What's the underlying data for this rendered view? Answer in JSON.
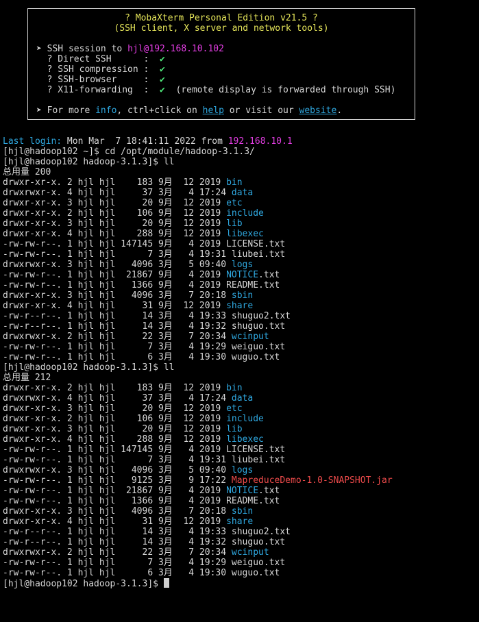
{
  "colors": {
    "background": "#000000",
    "text": "#d8d8d8",
    "banner_title": "#e6e65a",
    "check": "#4ee87a",
    "host": "#e23de2",
    "directory": "#2fa8e0",
    "archive": "#ef4b4b"
  },
  "banner": {
    "title": "? MobaXterm Personal Edition v21.5 ?",
    "subtitle": "(SSH client, X server and network tools)",
    "session_prefix": "➤ SSH session to ",
    "session_host": "hjl@192.168.10.102",
    "features": [
      {
        "label": "  ? Direct SSH      :  ",
        "check": "✔",
        "note": ""
      },
      {
        "label": "  ? SSH compression :  ",
        "check": "✔",
        "note": ""
      },
      {
        "label": "  ? SSH-browser     :  ",
        "check": "✔",
        "note": ""
      },
      {
        "label": "  ? X11-forwarding  :  ",
        "check": "✔",
        "note": "  (remote display is forwarded through SSH)"
      }
    ],
    "more_prefix": "➤ For more ",
    "info_text": "info",
    "more_mid": ", ctrl+click on ",
    "help_text": "help",
    "more_or": " or visit our ",
    "website_text": "website",
    "more_end": "."
  },
  "session": {
    "last_login_label": "Last login:",
    "last_login_time": " Mon Mar  7 18:41:11 2022 from ",
    "last_login_host": "192.168.10.1",
    "commands": [
      "[hjl@hadoop102 ~]$ cd /opt/module/hadoop-3.1.3/",
      "[hjl@hadoop102 hadoop-3.1.3]$ ll"
    ],
    "listing1_total": "总用量 200",
    "listing1": [
      {
        "meta": "drwxr-xr-x. 2 hjl hjl    183 9月  12 2019 ",
        "name": "bin",
        "kind": "dir"
      },
      {
        "meta": "drwxrwxr-x. 4 hjl hjl     37 3月   4 17:24 ",
        "name": "data",
        "kind": "dir"
      },
      {
        "meta": "drwxr-xr-x. 3 hjl hjl     20 9月  12 2019 ",
        "name": "etc",
        "kind": "dir"
      },
      {
        "meta": "drwxr-xr-x. 2 hjl hjl    106 9月  12 2019 ",
        "name": "include",
        "kind": "dir"
      },
      {
        "meta": "drwxr-xr-x. 3 hjl hjl     20 9月  12 2019 ",
        "name": "lib",
        "kind": "dir"
      },
      {
        "meta": "drwxr-xr-x. 4 hjl hjl    288 9月  12 2019 ",
        "name": "libexec",
        "kind": "dir"
      },
      {
        "meta": "-rw-rw-r--. 1 hjl hjl 147145 9月   4 2019 ",
        "name": "LICENSE.txt",
        "kind": "file"
      },
      {
        "meta": "-rw-rw-r--. 1 hjl hjl      7 3月   4 19:31 ",
        "name": "liubei.txt",
        "kind": "file"
      },
      {
        "meta": "drwxrwxr-x. 3 hjl hjl   4096 3月   5 09:40 ",
        "name": "logs",
        "kind": "dir"
      },
      {
        "meta": "-rw-rw-r--. 1 hjl hjl  21867 9月   4 2019 ",
        "name": "NOTICE",
        "suffix": ".txt",
        "kind": "dir"
      },
      {
        "meta": "-rw-rw-r--. 1 hjl hjl   1366 9月   4 2019 ",
        "name": "README.txt",
        "kind": "file"
      },
      {
        "meta": "drwxr-xr-x. 3 hjl hjl   4096 3月   7 20:18 ",
        "name": "sbin",
        "kind": "dir"
      },
      {
        "meta": "drwxr-xr-x. 4 hjl hjl     31 9月  12 2019 ",
        "name": "share",
        "kind": "dir"
      },
      {
        "meta": "-rw-r--r--. 1 hjl hjl     14 3月   4 19:33 ",
        "name": "shuguo2.txt",
        "kind": "file"
      },
      {
        "meta": "-rw-r--r--. 1 hjl hjl     14 3月   4 19:32 ",
        "name": "shuguo.txt",
        "kind": "file"
      },
      {
        "meta": "drwxrwxr-x. 2 hjl hjl     22 3月   7 20:34 ",
        "name": "wcinput",
        "kind": "dir"
      },
      {
        "meta": "-rw-rw-r--. 1 hjl hjl      7 3月   4 19:29 ",
        "name": "weiguo.txt",
        "kind": "file"
      },
      {
        "meta": "-rw-rw-r--. 1 hjl hjl      6 3月   4 19:30 ",
        "name": "wuguo.txt",
        "kind": "file"
      }
    ],
    "second_command": "[hjl@hadoop102 hadoop-3.1.3]$ ll",
    "listing2_total": "总用量 212",
    "listing2": [
      {
        "meta": "drwxr-xr-x. 2 hjl hjl    183 9月  12 2019 ",
        "name": "bin",
        "kind": "dir"
      },
      {
        "meta": "drwxrwxr-x. 4 hjl hjl     37 3月   4 17:24 ",
        "name": "data",
        "kind": "dir"
      },
      {
        "meta": "drwxr-xr-x. 3 hjl hjl     20 9月  12 2019 ",
        "name": "etc",
        "kind": "dir"
      },
      {
        "meta": "drwxr-xr-x. 2 hjl hjl    106 9月  12 2019 ",
        "name": "include",
        "kind": "dir"
      },
      {
        "meta": "drwxr-xr-x. 3 hjl hjl     20 9月  12 2019 ",
        "name": "lib",
        "kind": "dir"
      },
      {
        "meta": "drwxr-xr-x. 4 hjl hjl    288 9月  12 2019 ",
        "name": "libexec",
        "kind": "dir"
      },
      {
        "meta": "-rw-rw-r--. 1 hjl hjl 147145 9月   4 2019 ",
        "name": "LICENSE.txt",
        "kind": "file"
      },
      {
        "meta": "-rw-rw-r--. 1 hjl hjl      7 3月   4 19:31 ",
        "name": "liubei.txt",
        "kind": "file"
      },
      {
        "meta": "drwxrwxr-x. 3 hjl hjl   4096 3月   5 09:40 ",
        "name": "logs",
        "kind": "dir"
      },
      {
        "meta": "-rw-rw-r--. 1 hjl hjl   9125 3月   9 17:22 ",
        "name": "MapreduceDemo-1.0-SNAPSHOT.jar",
        "kind": "archive"
      },
      {
        "meta": "-rw-rw-r--. 1 hjl hjl  21867 9月   4 2019 ",
        "name": "NOTICE",
        "suffix": ".txt",
        "kind": "dir"
      },
      {
        "meta": "-rw-rw-r--. 1 hjl hjl   1366 9月   4 2019 ",
        "name": "README.txt",
        "kind": "file"
      },
      {
        "meta": "drwxr-xr-x. 3 hjl hjl   4096 3月   7 20:18 ",
        "name": "sbin",
        "kind": "dir"
      },
      {
        "meta": "drwxr-xr-x. 4 hjl hjl     31 9月  12 2019 ",
        "name": "share",
        "kind": "dir"
      },
      {
        "meta": "-rw-r--r--. 1 hjl hjl     14 3月   4 19:33 ",
        "name": "shuguo2.txt",
        "kind": "file"
      },
      {
        "meta": "-rw-r--r--. 1 hjl hjl     14 3月   4 19:32 ",
        "name": "shuguo.txt",
        "kind": "file"
      },
      {
        "meta": "drwxrwxr-x. 2 hjl hjl     22 3月   7 20:34 ",
        "name": "wcinput",
        "kind": "dir"
      },
      {
        "meta": "-rw-rw-r--. 1 hjl hjl      7 3月   4 19:29 ",
        "name": "weiguo.txt",
        "kind": "file"
      },
      {
        "meta": "-rw-rw-r--. 1 hjl hjl      6 3月   4 19:30 ",
        "name": "wuguo.txt",
        "kind": "file"
      }
    ],
    "final_prompt": "[hjl@hadoop102 hadoop-3.1.3]$ "
  }
}
